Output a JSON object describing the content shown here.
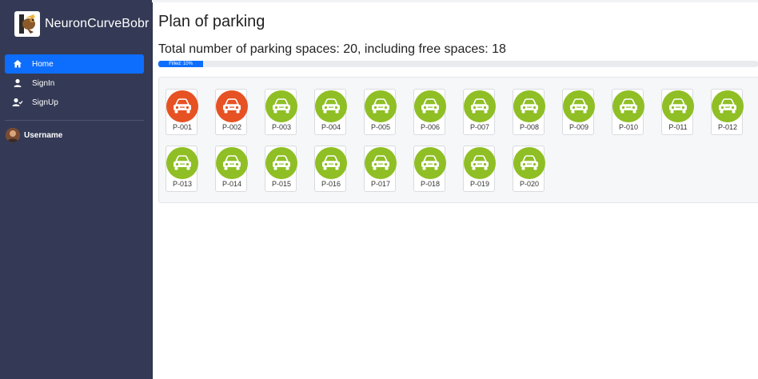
{
  "app": {
    "name": "NeuronCurveBobr"
  },
  "sidebar": {
    "items": [
      {
        "label": "Home",
        "icon": "home-icon",
        "active": true
      },
      {
        "label": "SignIn",
        "icon": "user-icon",
        "active": false
      },
      {
        "label": "SignUp",
        "icon": "user-check-icon",
        "active": false
      }
    ],
    "user": {
      "name": "Username"
    }
  },
  "main": {
    "title": "Plan of parking",
    "summary": "Total number of parking spaces: 20, including free spaces: 18",
    "progress": {
      "label": "Filled: 10%",
      "value_percent": 10
    }
  },
  "colors": {
    "occupied": "#e65223",
    "free": "#8fbf25",
    "accent": "#0d6efd",
    "sidebar": "#343a55"
  },
  "spots": [
    {
      "id": "P-001",
      "status": "occupied"
    },
    {
      "id": "P-002",
      "status": "occupied"
    },
    {
      "id": "P-003",
      "status": "free"
    },
    {
      "id": "P-004",
      "status": "free"
    },
    {
      "id": "P-005",
      "status": "free"
    },
    {
      "id": "P-006",
      "status": "free"
    },
    {
      "id": "P-007",
      "status": "free"
    },
    {
      "id": "P-008",
      "status": "free"
    },
    {
      "id": "P-009",
      "status": "free"
    },
    {
      "id": "P-010",
      "status": "free"
    },
    {
      "id": "P-011",
      "status": "free"
    },
    {
      "id": "P-012",
      "status": "free"
    },
    {
      "id": "P-013",
      "status": "free"
    },
    {
      "id": "P-014",
      "status": "free"
    },
    {
      "id": "P-015",
      "status": "free"
    },
    {
      "id": "P-016",
      "status": "free"
    },
    {
      "id": "P-017",
      "status": "free"
    },
    {
      "id": "P-018",
      "status": "free"
    },
    {
      "id": "P-019",
      "status": "free"
    },
    {
      "id": "P-020",
      "status": "free"
    }
  ]
}
